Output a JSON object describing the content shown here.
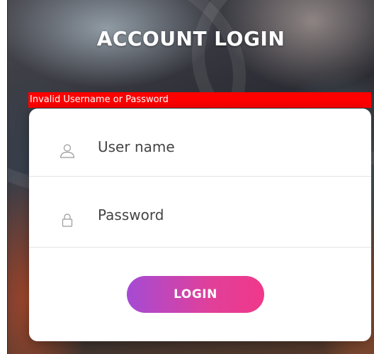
{
  "header": {
    "title": "ACCOUNT LOGIN"
  },
  "alert": {
    "message": "Invalid Username or Password",
    "color": "#ff0000"
  },
  "form": {
    "username": {
      "placeholder": "User name",
      "value": "",
      "icon": "user-icon"
    },
    "password": {
      "placeholder": "Password",
      "value": "",
      "icon": "lock-icon"
    },
    "submit_label": "LOGIN"
  },
  "colors": {
    "button_gradient_start": "#a54bd4",
    "button_gradient_end": "#f0388a"
  }
}
